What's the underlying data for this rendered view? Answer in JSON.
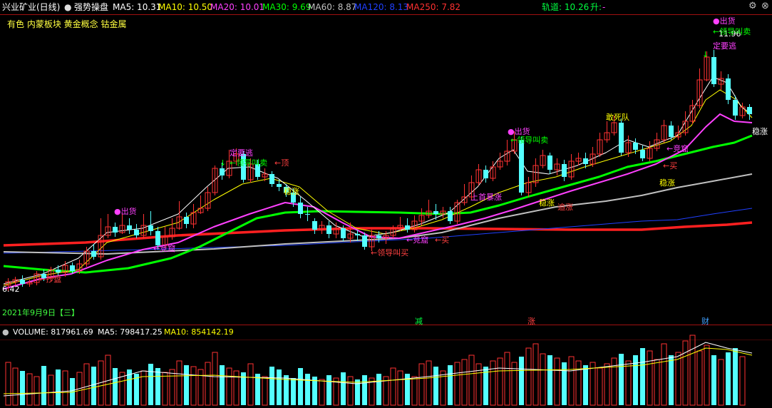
{
  "header": {
    "stock_name": "兴业矿业(日线)",
    "indicator_name": "强势操盘",
    "ma5": "MA5: 10.31",
    "ma10": "MA10: 10.50",
    "ma20": "MA20: 10.01",
    "ma30": "MA30: 9.69",
    "ma60": "MA60: 8.87",
    "ma120": "MA120: 8.13",
    "ma250": "MA250: 7.82",
    "track": "轨道: 10.26",
    "track_state": "升:",
    "track_tail": "-"
  },
  "tags": "有色 内蒙板块 黄金概念 钴金属",
  "colors": {
    "up": "#ff3232",
    "down": "#54ffff",
    "ma5": "#ffffff",
    "ma10": "#ffff00",
    "ma20": "#ff40ff",
    "ma30": "#00ff00",
    "ma60": "#c0c0c0",
    "ma120": "#2040ff",
    "ma250": "#ff2020"
  },
  "chart": {
    "low_price": "6.42",
    "high_price": "11.96",
    "date_label": "2021年9月9日【三】",
    "labels": {
      "chuhuo": "出货",
      "dingyaotao": "定要逃",
      "lingdao_maichu": "←领导叫卖",
      "ding": "←顶",
      "wenzhang": "稳涨",
      "lingdao_maimai": "←领导叫买",
      "ganshidui": "敢死队",
      "jingzhan": "←竞窟",
      "mai": "←买",
      "zhuibao": "←抄盘",
      "qihuo": "追涨",
      "jiucheng": "上首暴涨"
    },
    "markers": {
      "jian": "减",
      "zhang": "涨",
      "cai": "财"
    }
  },
  "volume": {
    "volume": "VOLUME: 817961.69",
    "ma5": "MA5: 798417.25",
    "ma10": "MA10: 854142.19"
  }
}
